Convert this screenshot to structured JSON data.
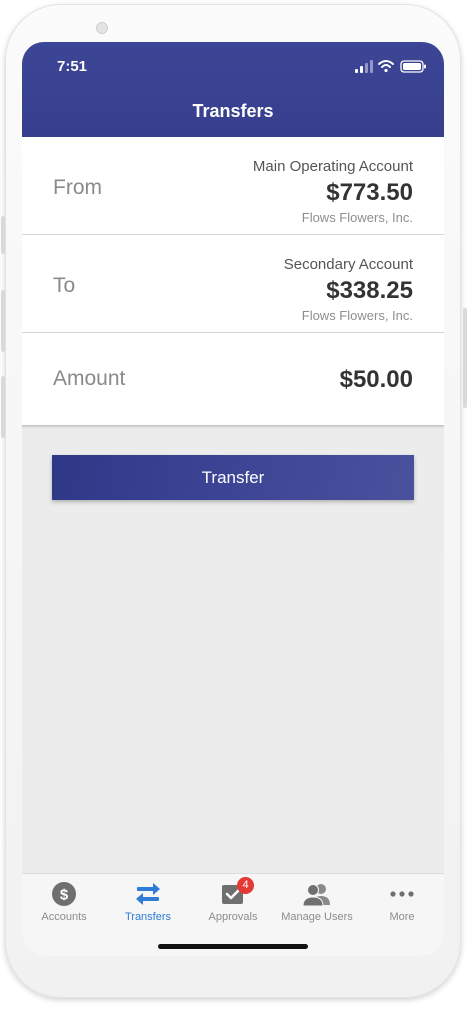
{
  "status_bar": {
    "time": "7:51"
  },
  "header": {
    "title": "Transfers"
  },
  "from": {
    "label": "From",
    "account_name": "Main Operating Account",
    "balance": "$773.50",
    "company": "Flows Flowers, Inc."
  },
  "to": {
    "label": "To",
    "account_name": "Secondary Account",
    "balance": "$338.25",
    "company": "Flows Flowers, Inc."
  },
  "amount": {
    "label": "Amount",
    "value": "$50.00"
  },
  "transfer_button": {
    "label": "Transfer"
  },
  "tabs": [
    {
      "label": "Accounts",
      "icon": "dollar-circle-icon",
      "active": false
    },
    {
      "label": "Transfers",
      "icon": "transfer-arrows-icon",
      "active": true
    },
    {
      "label": "Approvals",
      "icon": "approval-check-icon",
      "active": false,
      "badge": "4"
    },
    {
      "label": "Manage Users",
      "icon": "users-icon",
      "active": false
    },
    {
      "label": "More",
      "icon": "more-dots-icon",
      "active": false
    }
  ],
  "colors": {
    "header_bg": "#3a4291",
    "active_tab": "#2f7bd8",
    "badge": "#e53935",
    "button_bg": "#363e8d"
  }
}
